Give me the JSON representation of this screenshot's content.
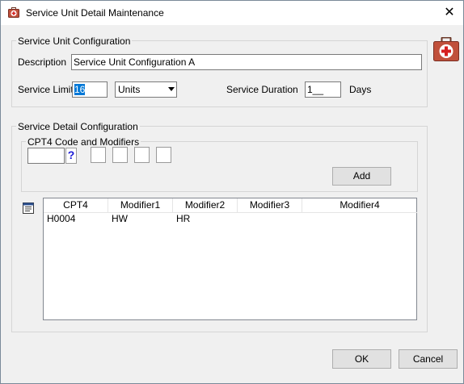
{
  "window": {
    "title": "Service Unit Detail Maintenance",
    "close_symbol": "✕"
  },
  "service_unit": {
    "legend": "Service Unit Configuration",
    "description_label": "Description",
    "description_value": "Service Unit Configuration A",
    "limit_label": "Service Limit",
    "limit_value": "16",
    "unit_value": "Units",
    "duration_label": "Service Duration",
    "duration_value": "1__",
    "duration_unit": "Days"
  },
  "service_detail": {
    "legend": "Service Detail Configuration",
    "cpt_legend": "CPT4 Code and Modifiers",
    "lookup_symbol": "?",
    "add_label": "Add"
  },
  "grid": {
    "columns": [
      "CPT4",
      "Modifier1",
      "Modifier2",
      "Modifier3",
      "Modifier4"
    ],
    "rows": [
      [
        "H0004",
        "HW",
        "HR",
        "",
        ""
      ]
    ]
  },
  "footer": {
    "ok_label": "OK",
    "cancel_label": "Cancel"
  },
  "icons": {
    "app": "medical-kit-icon",
    "kit": "medical-kit-icon",
    "notes": "notes-icon",
    "close": "close-icon"
  },
  "colors": {
    "kit_body": "#c0503b",
    "selection": "#0078d7"
  }
}
